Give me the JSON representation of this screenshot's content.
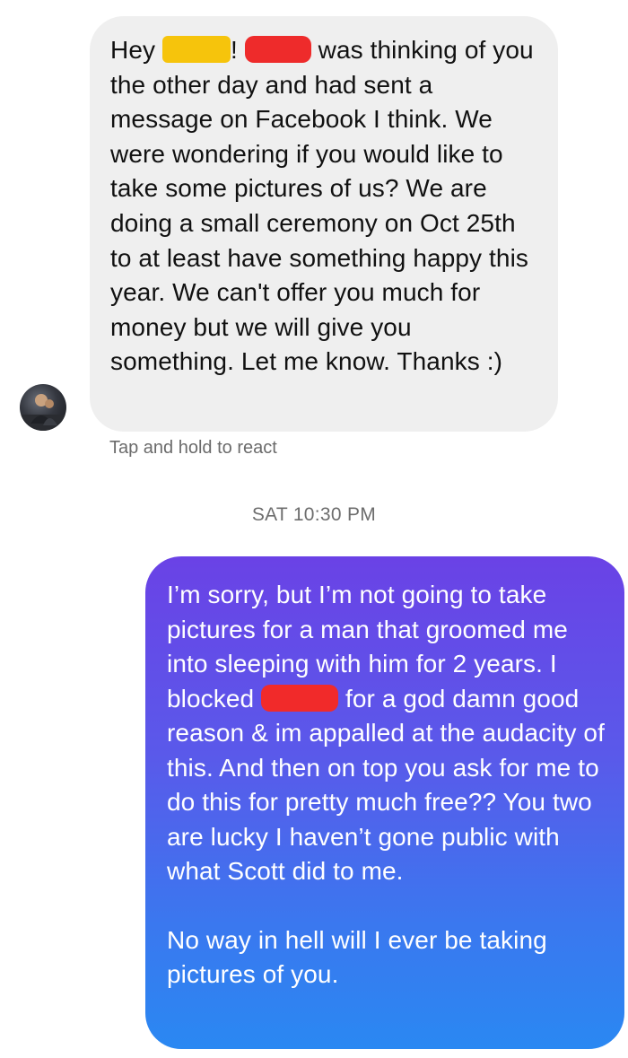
{
  "thread": {
    "incoming_message": {
      "greeting": "Hey",
      "exclamation": "!",
      "rest": "was thinking of you the other day and had sent a message on Facebook I think. We were wondering if you would like to take some pictures of us? We are doing a small ceremony on Oct 25th to at least have something happy this year. We can't offer you much for money but we will give you something. Let me know. Thanks :)",
      "redaction_colors": [
        "#f6c40c",
        "#ee2b2b"
      ]
    },
    "react_hint": "Tap and hold to react",
    "timestamp": "SAT 10:30 PM",
    "outgoing_message": {
      "part1": "I’m sorry, but I’m not going to take pictures for a man that groomed me into sleeping with him for 2 years. I blocked",
      "part2": "for a god damn good reason & im appalled at the audacity of this. And then on top you ask for me to do this for pretty much free?? You two are lucky I haven’t gone public with what Scott did to me.",
      "part3": "No way in hell will I ever be taking pictures of you.",
      "redaction_color": "#f12a2a",
      "gradient": [
        "#6a42e6",
        "#2a88f2"
      ]
    }
  }
}
